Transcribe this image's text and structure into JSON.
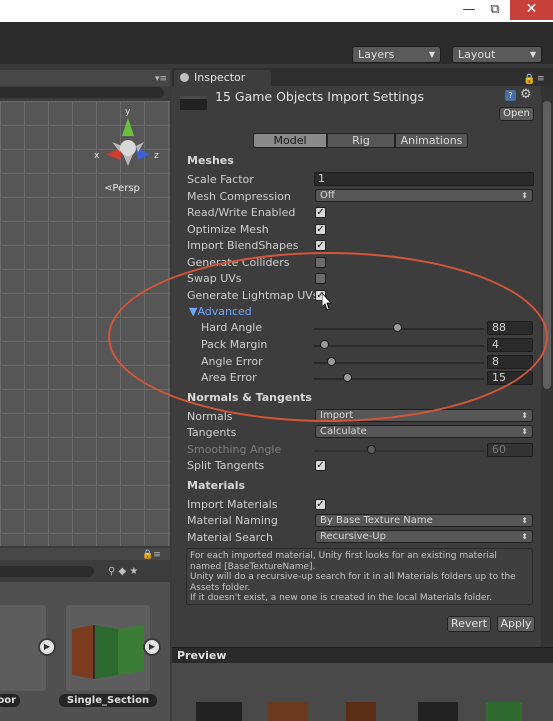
{
  "window": {
    "minimize": "—",
    "maximize": "⧉",
    "close": "✕"
  },
  "toolbar": {
    "layers": "Layers",
    "layout": "Layout"
  },
  "scene": {
    "persp": "⋖Persp",
    "axis_y": "y",
    "axis_x": "x",
    "axis_z": "z"
  },
  "project": {
    "items": [
      "oor",
      "Single_Section"
    ]
  },
  "inspector": {
    "tab": "Inspector",
    "title": "15 Game Objects Import Settings",
    "open": "Open",
    "tabs": [
      "Model",
      "Rig",
      "Animations"
    ],
    "meshes": {
      "heading": "Meshes",
      "scale_factor_label": "Scale Factor",
      "scale_factor": "1",
      "mesh_compression_label": "Mesh Compression",
      "mesh_compression": "Off",
      "read_write_label": "Read/Write Enabled",
      "read_write": true,
      "optimize_mesh_label": "Optimize Mesh",
      "optimize_mesh": true,
      "import_blendshapes_label": "Import BlendShapes",
      "import_blendshapes": true,
      "generate_colliders_label": "Generate Colliders",
      "generate_colliders": false,
      "swap_uvs_label": "Swap UVs",
      "swap_uvs": false,
      "generate_lightmap_label": "Generate Lightmap UVs",
      "generate_lightmap": true,
      "advanced_label": "▼Advanced",
      "hard_angle_label": "Hard Angle",
      "hard_angle": "88",
      "pack_margin_label": "Pack Margin",
      "pack_margin": "4",
      "angle_error_label": "Angle Error",
      "angle_error": "8",
      "area_error_label": "Area Error",
      "area_error": "15"
    },
    "normals": {
      "heading": "Normals & Tangents",
      "normals_label": "Normals",
      "normals": "Import",
      "tangents_label": "Tangents",
      "tangents": "Calculate",
      "smoothing_label": "Smoothing Angle",
      "smoothing": "60",
      "split_label": "Split Tangents",
      "split": true
    },
    "materials": {
      "heading": "Materials",
      "import_label": "Import Materials",
      "import": true,
      "naming_label": "Material Naming",
      "naming": "By Base Texture Name",
      "search_label": "Material Search",
      "search": "Recursive-Up",
      "help_1": "For each imported material, Unity first looks for an existing material named [BaseTextureName].",
      "help_2": "Unity will do a recursive-up search for it in all Materials folders up to the Assets folder.",
      "help_3": "If it doesn't exist, a new one is created in the local Materials folder."
    },
    "revert": "Revert",
    "apply": "Apply",
    "preview": "Preview"
  },
  "colors": {
    "annotation": "#d5553a",
    "accent_blue": "#6fa6ff",
    "close_red": "#c7413a"
  }
}
